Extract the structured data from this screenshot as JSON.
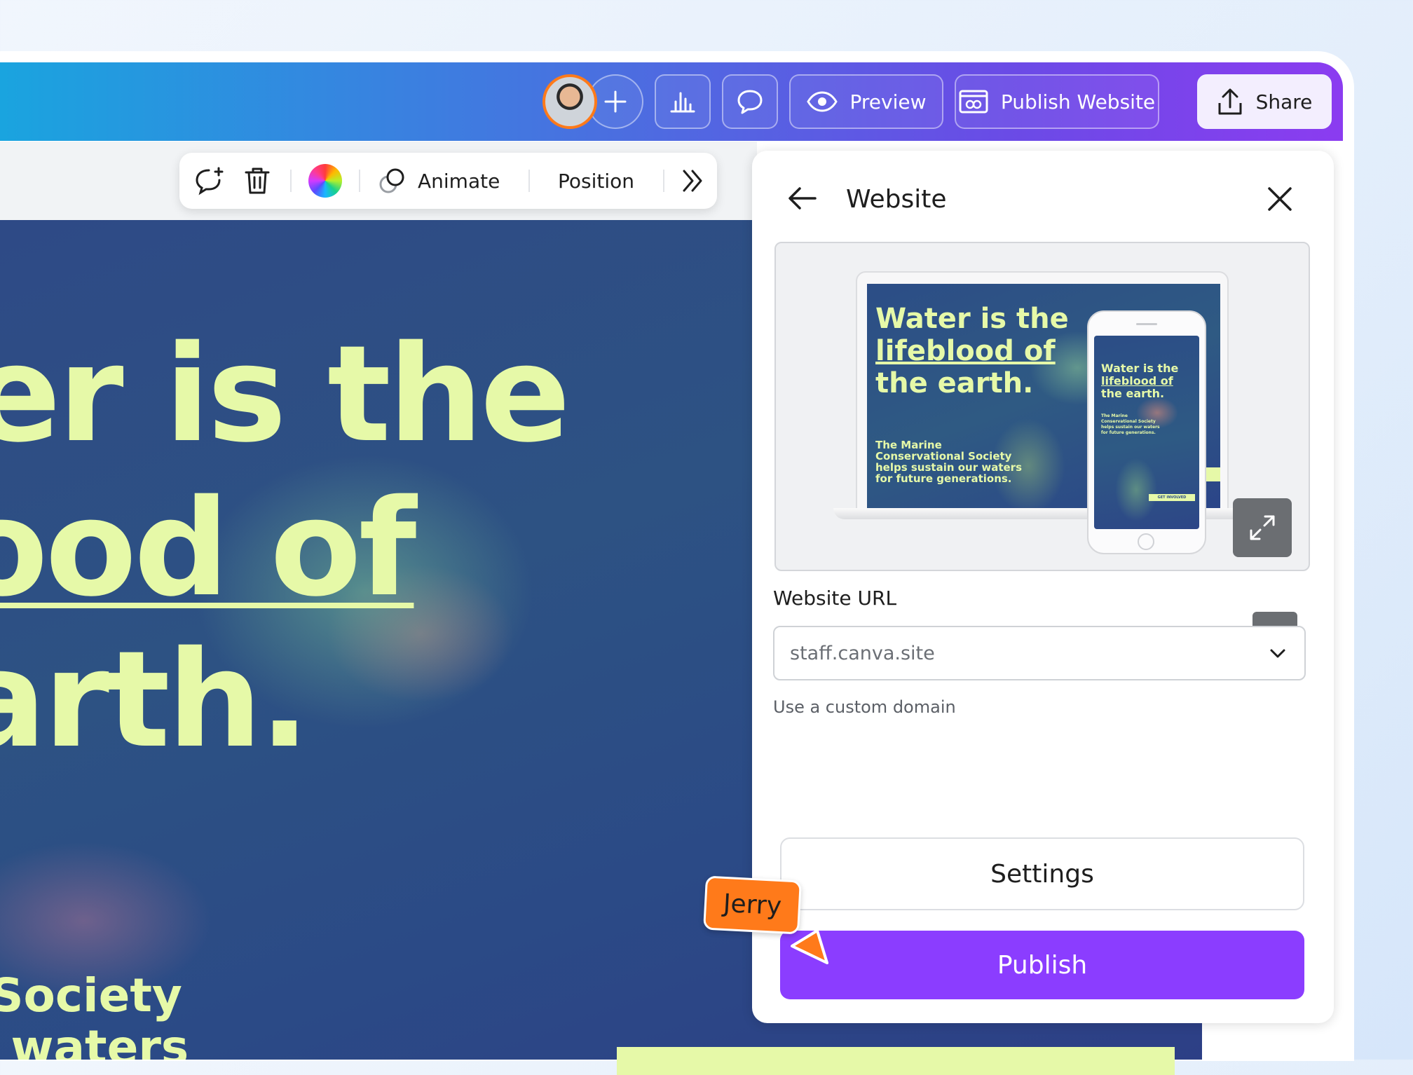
{
  "toolbar": {
    "preview_label": "Preview",
    "publish_website_label": "Publish Website",
    "share_label": "Share"
  },
  "context_toolbar": {
    "animate_label": "Animate",
    "position_label": "Position"
  },
  "canvas": {
    "hero_lines": [
      "er is the",
      "ood of",
      "arth."
    ],
    "sub_lines": [
      "Society",
      "r waters"
    ]
  },
  "panel": {
    "title": "Website",
    "preview": {
      "laptop_title": [
        "Water is the",
        "lifeblood of",
        "the earth."
      ],
      "laptop_body": [
        "The Marine",
        "Conservational Society",
        "helps sustain our waters",
        "for future generations."
      ],
      "phone_title": [
        "Water is the",
        "lifeblood of",
        "the earth."
      ],
      "phone_body": [
        "The Marine",
        "Conservational Society",
        "helps sustain our waters",
        "for future generations."
      ],
      "phone_button": "GET INVOLVED"
    },
    "url_label": "Website URL",
    "url_value": "staff.canva.site",
    "custom_domain_label": "Use a custom domain",
    "settings_label": "Settings",
    "publish_label": "Publish"
  },
  "collaborator": {
    "cursor_name": "Jerry"
  },
  "colors": {
    "accent": "#8b3dff",
    "lime": "#e6f9a8",
    "cursor": "#ff7a1a"
  }
}
